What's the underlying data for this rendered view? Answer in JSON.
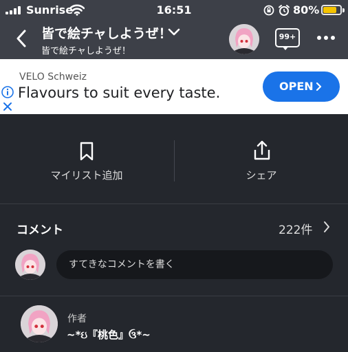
{
  "status_bar": {
    "carrier": "Sunrise",
    "time": "16:51",
    "battery_percent": "80%",
    "battery_level": 0.8,
    "icons": [
      "signal-icon",
      "wifi-icon",
      "rotation-lock-icon",
      "alarm-icon",
      "battery-icon"
    ]
  },
  "header": {
    "title": "皆で絵チャしようぜ！",
    "subtitle": "皆で絵チャしようぜ！",
    "notification_badge": "99+",
    "icons": [
      "back-arrow-icon",
      "chevron-down-icon",
      "avatar",
      "chat-notification-icon",
      "more-icon"
    ]
  },
  "ad": {
    "sponsor": "VELO Schweiz",
    "headline": "Flavours to suit every taste.",
    "cta": "OPEN",
    "cta_color": "#1a73e8",
    "icons": [
      "info-icon",
      "close-icon",
      "chevron-right-icon"
    ]
  },
  "actions": [
    {
      "label": "マイリスト追加",
      "icon": "bookmark-icon"
    },
    {
      "label": "シェア",
      "icon": "share-icon"
    }
  ],
  "comments": {
    "title": "コメント",
    "count": "222件",
    "placeholder": "すてきなコメントを書く"
  },
  "author": {
    "label": "作者",
    "name": "~*ઇ『桃色』ઉ*~"
  },
  "colors": {
    "background": "#24272d",
    "header": "#3d4048",
    "battery": "#f5c400"
  }
}
